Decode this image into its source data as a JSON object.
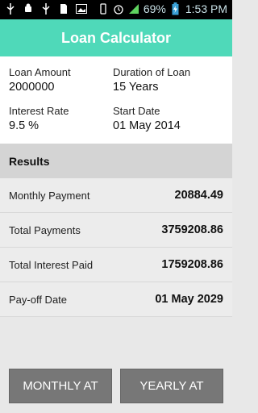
{
  "status_bar": {
    "battery_percent": "69%",
    "time": "1:53 PM",
    "icons": [
      "usb-icon",
      "android-debug-icon",
      "usb-icon",
      "sd-card-icon",
      "image-icon",
      "vibrate-icon",
      "alarm-icon",
      "signal-icon",
      "battery-charging-icon"
    ]
  },
  "app_bar": {
    "title": "Loan Calculator"
  },
  "inputs": {
    "loan_amount": {
      "label": "Loan Amount",
      "value": "2000000"
    },
    "duration": {
      "label": "Duration of Loan",
      "value": "15 Years"
    },
    "interest_rate": {
      "label": "Interest Rate",
      "value": "9.5 %"
    },
    "start_date": {
      "label": "Start Date",
      "value": "01 May 2014"
    }
  },
  "results": {
    "header": "Results",
    "rows": [
      {
        "label": "Monthly Payment",
        "value": "20884.49"
      },
      {
        "label": "Total Payments",
        "value": "3759208.86"
      },
      {
        "label": "Total Interest Paid",
        "value": "1759208.86"
      },
      {
        "label": "Pay-off Date",
        "value": "01 May 2029"
      }
    ]
  },
  "buttons": {
    "monthly": "MONTHLY AT",
    "yearly": "YEARLY AT"
  },
  "colors": {
    "accent": "#4fd9b9",
    "button": "#777777",
    "results_header": "#d4d4d4"
  }
}
